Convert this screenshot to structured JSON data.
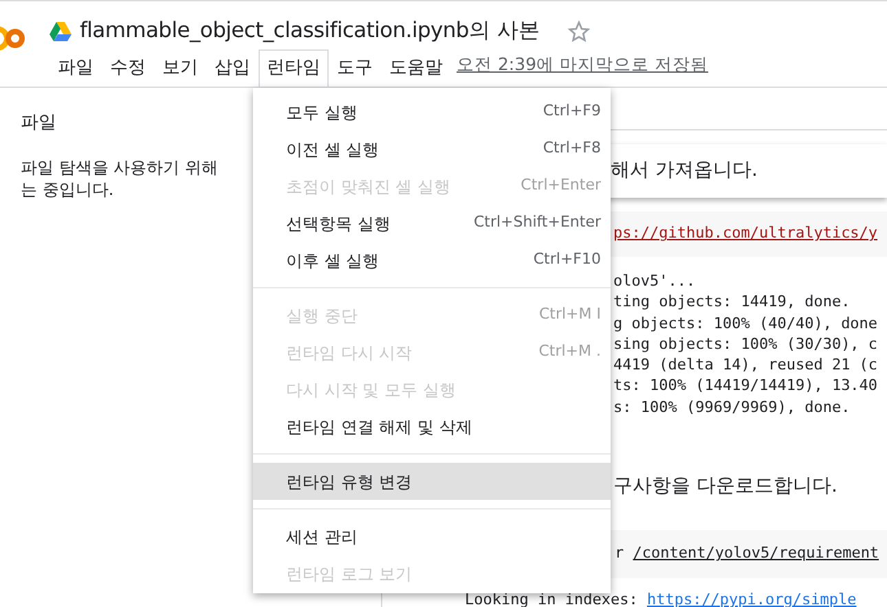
{
  "header": {
    "title": "flammable_object_classification.ipynb의 사본",
    "starred": false,
    "menus": [
      {
        "label": "파일",
        "selected": false
      },
      {
        "label": "수정",
        "selected": false
      },
      {
        "label": "보기",
        "selected": false
      },
      {
        "label": "삽입",
        "selected": false
      },
      {
        "label": "런타임",
        "selected": true
      },
      {
        "label": "도구",
        "selected": false
      },
      {
        "label": "도움말",
        "selected": false
      }
    ],
    "saved": "오전 2:39에 마지막으로 저장됨"
  },
  "sidebar": {
    "title": "파일",
    "message_line_1": "파일 탐색을 사용하기 위해",
    "message_line_2": "는 중입니다."
  },
  "runtime_menu": [
    {
      "kind": "item",
      "label": "모두 실행",
      "shortcut": "Ctrl+F9",
      "disabled": false,
      "selected": false
    },
    {
      "kind": "item",
      "label": "이전 셀 실행",
      "shortcut": "Ctrl+F8",
      "disabled": false,
      "selected": false
    },
    {
      "kind": "item",
      "label": "초점이 맞춰진 셀 실행",
      "shortcut": "Ctrl+Enter",
      "disabled": true,
      "selected": false
    },
    {
      "kind": "item",
      "label": "선택항목 실행",
      "shortcut": "Ctrl+Shift+Enter",
      "disabled": false,
      "selected": false
    },
    {
      "kind": "item",
      "label": "이후 셀 실행",
      "shortcut": "Ctrl+F10",
      "disabled": false,
      "selected": false
    },
    {
      "kind": "divider"
    },
    {
      "kind": "item",
      "label": "실행 중단",
      "shortcut": "Ctrl+M I",
      "disabled": true,
      "selected": false
    },
    {
      "kind": "item",
      "label": "런타임 다시 시작",
      "shortcut": "Ctrl+M .",
      "disabled": true,
      "selected": false
    },
    {
      "kind": "item",
      "label": "다시 시작 및 모두 실행",
      "disabled": true,
      "selected": false
    },
    {
      "kind": "item",
      "label": "런타임 연결 해제 및 삭제",
      "disabled": false,
      "selected": false
    },
    {
      "kind": "divider"
    },
    {
      "kind": "item",
      "label": "런타임 유형 변경",
      "disabled": false,
      "selected": true
    },
    {
      "kind": "divider"
    },
    {
      "kind": "item",
      "label": "세션 관리",
      "disabled": false,
      "selected": false
    },
    {
      "kind": "item",
      "label": "런타임 로그 보기",
      "disabled": true,
      "selected": false
    }
  ],
  "notebook": {
    "text_cell_1": "해서 가져옵니다.",
    "code_cell_1": {
      "link": "ps://github.com/ultralytics/y"
    },
    "output_lines": [
      "olov5'...",
      "ting objects: 14419, done.",
      "g objects: 100% (40/40), done",
      "sing objects: 100% (30/30), c",
      "4419 (delta 14), reused 21 (c",
      "ts: 100% (14419/14419), 13.40",
      "s: 100% (9969/9969), done."
    ],
    "text_cell_2": "구사항을 다운로드합니다.",
    "code_cell_2": {
      "prefix": "r ",
      "path": "/content/yolov5/requirement"
    },
    "output_2": {
      "text": "Looking in indexes: ",
      "link": "https://pypi.org/simple"
    }
  }
}
